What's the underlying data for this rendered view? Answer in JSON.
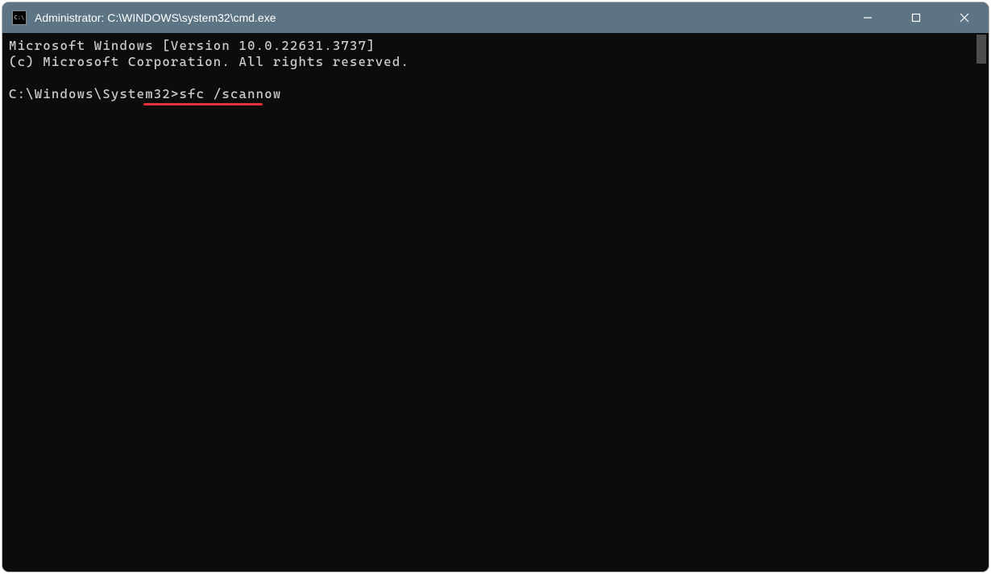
{
  "window": {
    "title": "Administrator: C:\\WINDOWS\\system32\\cmd.exe",
    "icon_label": "cmd-icon",
    "icon_glyph": "C:\\"
  },
  "controls": {
    "minimize": "minimize",
    "maximize": "maximize",
    "close": "close"
  },
  "terminal": {
    "line1": "Microsoft Windows [Version 10.0.22631.3737]",
    "line2": "(c) Microsoft Corporation. All rights reserved.",
    "blank": "",
    "prompt": "C:\\Windows\\System32>",
    "command": "sfc /scannow"
  },
  "annotation": {
    "underline_color": "#e8313b"
  }
}
